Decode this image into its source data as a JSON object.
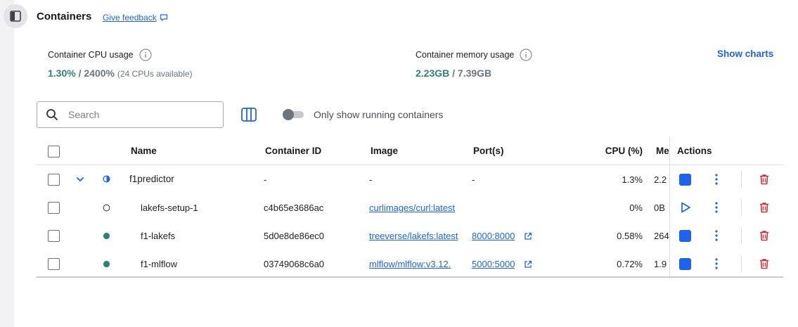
{
  "header": {
    "title": "Containers",
    "feedback_label": "Give feedback"
  },
  "stats": {
    "cpu": {
      "label": "Container CPU usage",
      "used": "1.30%",
      "separator": " / ",
      "total": "2400%",
      "note": "(24 CPUs available)"
    },
    "memory": {
      "label": "Container memory usage",
      "used": "2.23GB",
      "separator": " / ",
      "total": "7.39GB"
    },
    "show_charts_label": "Show charts"
  },
  "toolbar": {
    "search_placeholder": "Search",
    "running_toggle_label": "Only show running containers",
    "running_toggle_on": false
  },
  "table": {
    "columns": {
      "name": "Name",
      "container_id": "Container ID",
      "image": "Image",
      "ports": "Port(s)",
      "cpu": "CPU (%)",
      "memory": "Me",
      "actions": "Actions"
    },
    "rows": [
      {
        "name": "f1predictor",
        "id": "-",
        "image": "-",
        "ports": "-",
        "cpu": "1.3%",
        "memory": "2.2",
        "status": "partial",
        "action": "stop"
      },
      {
        "name": "lakefs-setup-1",
        "id": "c4b65e3686ac",
        "image": "curlimages/curl:latest",
        "ports": "",
        "cpu": "0%",
        "memory": "0B",
        "status": "stopped",
        "action": "start"
      },
      {
        "name": "f1-lakefs",
        "id": "5d0e8de86ec0",
        "image": "treeverse/lakefs:latest",
        "ports": "8000:8000",
        "cpu": "0.58%",
        "memory": "264",
        "status": "running",
        "action": "stop"
      },
      {
        "name": "f1-mlflow",
        "id": "03749068c6a0",
        "image": "mlflow/mlflow:v3.12.",
        "ports": "5000:5000",
        "cpu": "0.72%",
        "memory": "1.9",
        "status": "running",
        "action": "stop"
      }
    ]
  },
  "colors": {
    "accent_blue": "#1d63ed",
    "running_green": "#2e8272",
    "delete_red": "#d4303b"
  }
}
